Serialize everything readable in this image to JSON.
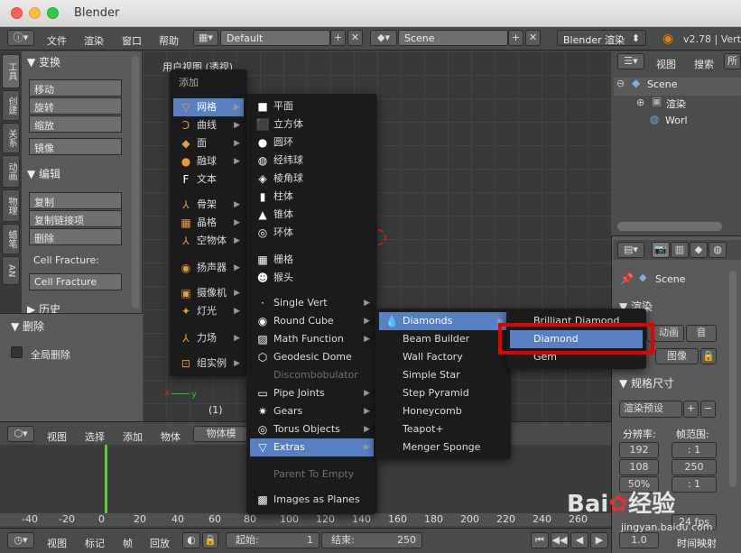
{
  "app": {
    "title": "Blender"
  },
  "topbar": {
    "menus": [
      "文件",
      "渲染",
      "窗口",
      "帮助"
    ],
    "layout": "Default",
    "scene": "Scene",
    "engine": "Blender 渲染",
    "version": "v2.78 | Vert"
  },
  "left_tabs": [
    "工具",
    "创建",
    "关系",
    "动画",
    "物理",
    "蜡笔",
    "AN"
  ],
  "tool_panel": {
    "transform_title": "变换",
    "transform_buttons": [
      "移动",
      "旋转",
      "缩放"
    ],
    "mirror": "镜像",
    "edit_title": "编辑",
    "edit_buttons": [
      "复制",
      "复制链接项",
      "删除"
    ],
    "cell_fracture_label": "Cell Fracture:",
    "cell_fracture_button": "Cell Fracture",
    "history_title": "历史"
  },
  "delete_panel": {
    "title": "删除",
    "checkbox_label": "全局删除"
  },
  "viewport": {
    "label": "用户视图 (透视)",
    "frame": "(1)"
  },
  "add_menu": {
    "title": "添加",
    "items": [
      {
        "label": "网格",
        "icon": "mesh-icon"
      },
      {
        "label": "曲线",
        "icon": "curve-icon"
      },
      {
        "label": "面",
        "icon": "surface-icon"
      },
      {
        "label": "融球",
        "icon": "metaball-icon"
      },
      {
        "label": "文本",
        "icon": "text-icon"
      },
      {
        "label": "骨架",
        "icon": "armature-icon"
      },
      {
        "label": "晶格",
        "icon": "lattice-icon"
      },
      {
        "label": "空物体",
        "icon": "empty-icon"
      },
      {
        "label": "扬声器",
        "icon": "speaker-icon"
      },
      {
        "label": "摄像机",
        "icon": "camera-icon"
      },
      {
        "label": "灯光",
        "icon": "lamp-icon"
      },
      {
        "label": "力场",
        "icon": "forcefield-icon"
      },
      {
        "label": "组实例",
        "icon": "group-instance-icon"
      }
    ]
  },
  "mesh_menu": {
    "items": [
      "平面",
      "立方体",
      "圆环",
      "经纬球",
      "棱角球",
      "柱体",
      "锥体",
      "环体",
      "栅格",
      "猴头",
      "Single Vert",
      "Round Cube",
      "Math Function",
      "Geodesic Dome",
      "Discombobulator",
      "Pipe Joints",
      "Gears",
      "Torus Objects",
      "Extras",
      "Parent To Empty",
      "Images as Planes"
    ]
  },
  "extras_menu": {
    "items": [
      "Diamonds",
      "Beam Builder",
      "Wall Factory",
      "Simple Star",
      "Step Pyramid",
      "Honeycomb",
      "Teapot+",
      "Menger Sponge"
    ]
  },
  "diamonds_menu": {
    "items": [
      "Brilliant Diamond",
      "Diamond",
      "Gem"
    ]
  },
  "outliner": {
    "menus": [
      "视图",
      "搜索"
    ],
    "tree": [
      "Scene",
      "渲染",
      "Worl"
    ]
  },
  "properties": {
    "scene": "Scene",
    "render_title": "渲染",
    "render_buttons": [
      "渲染",
      "动画",
      "音"
    ],
    "display_label": "图像",
    "dimensions_title": "规格尺寸",
    "preset": "渲染预设",
    "resolution_label": "分辨率:",
    "res_x": "192",
    "res_y": "108",
    "res_pct": "50%",
    "frame_range_label": "帧范围:",
    "frame_start": ":  1",
    "frame_end": "250",
    "frame_step": ":  1",
    "fps": "24 fps",
    "time_remap": "时间映射",
    "remap_val": "1.0"
  },
  "bottom_3d_header": {
    "menus": [
      "视图",
      "选择",
      "添加",
      "物体"
    ],
    "mode": "物体模",
    "global": "全局"
  },
  "timeline": {
    "ruler": [
      "-40",
      "-20",
      "0",
      "20",
      "40",
      "60",
      "80",
      "100",
      "120",
      "140",
      "160",
      "180",
      "200",
      "220",
      "240",
      "260"
    ],
    "menus": [
      "视图",
      "标记",
      "帧",
      "回放"
    ],
    "start_label": "起始:",
    "start": "1",
    "end_label": "结束:",
    "end": "250"
  },
  "watermark": {
    "brand": "Bai",
    "brand2": "经验",
    "url": "jingyan.baidu.com"
  },
  "colors": {
    "highlight": "#5680c2",
    "red_box": "#e30000"
  }
}
